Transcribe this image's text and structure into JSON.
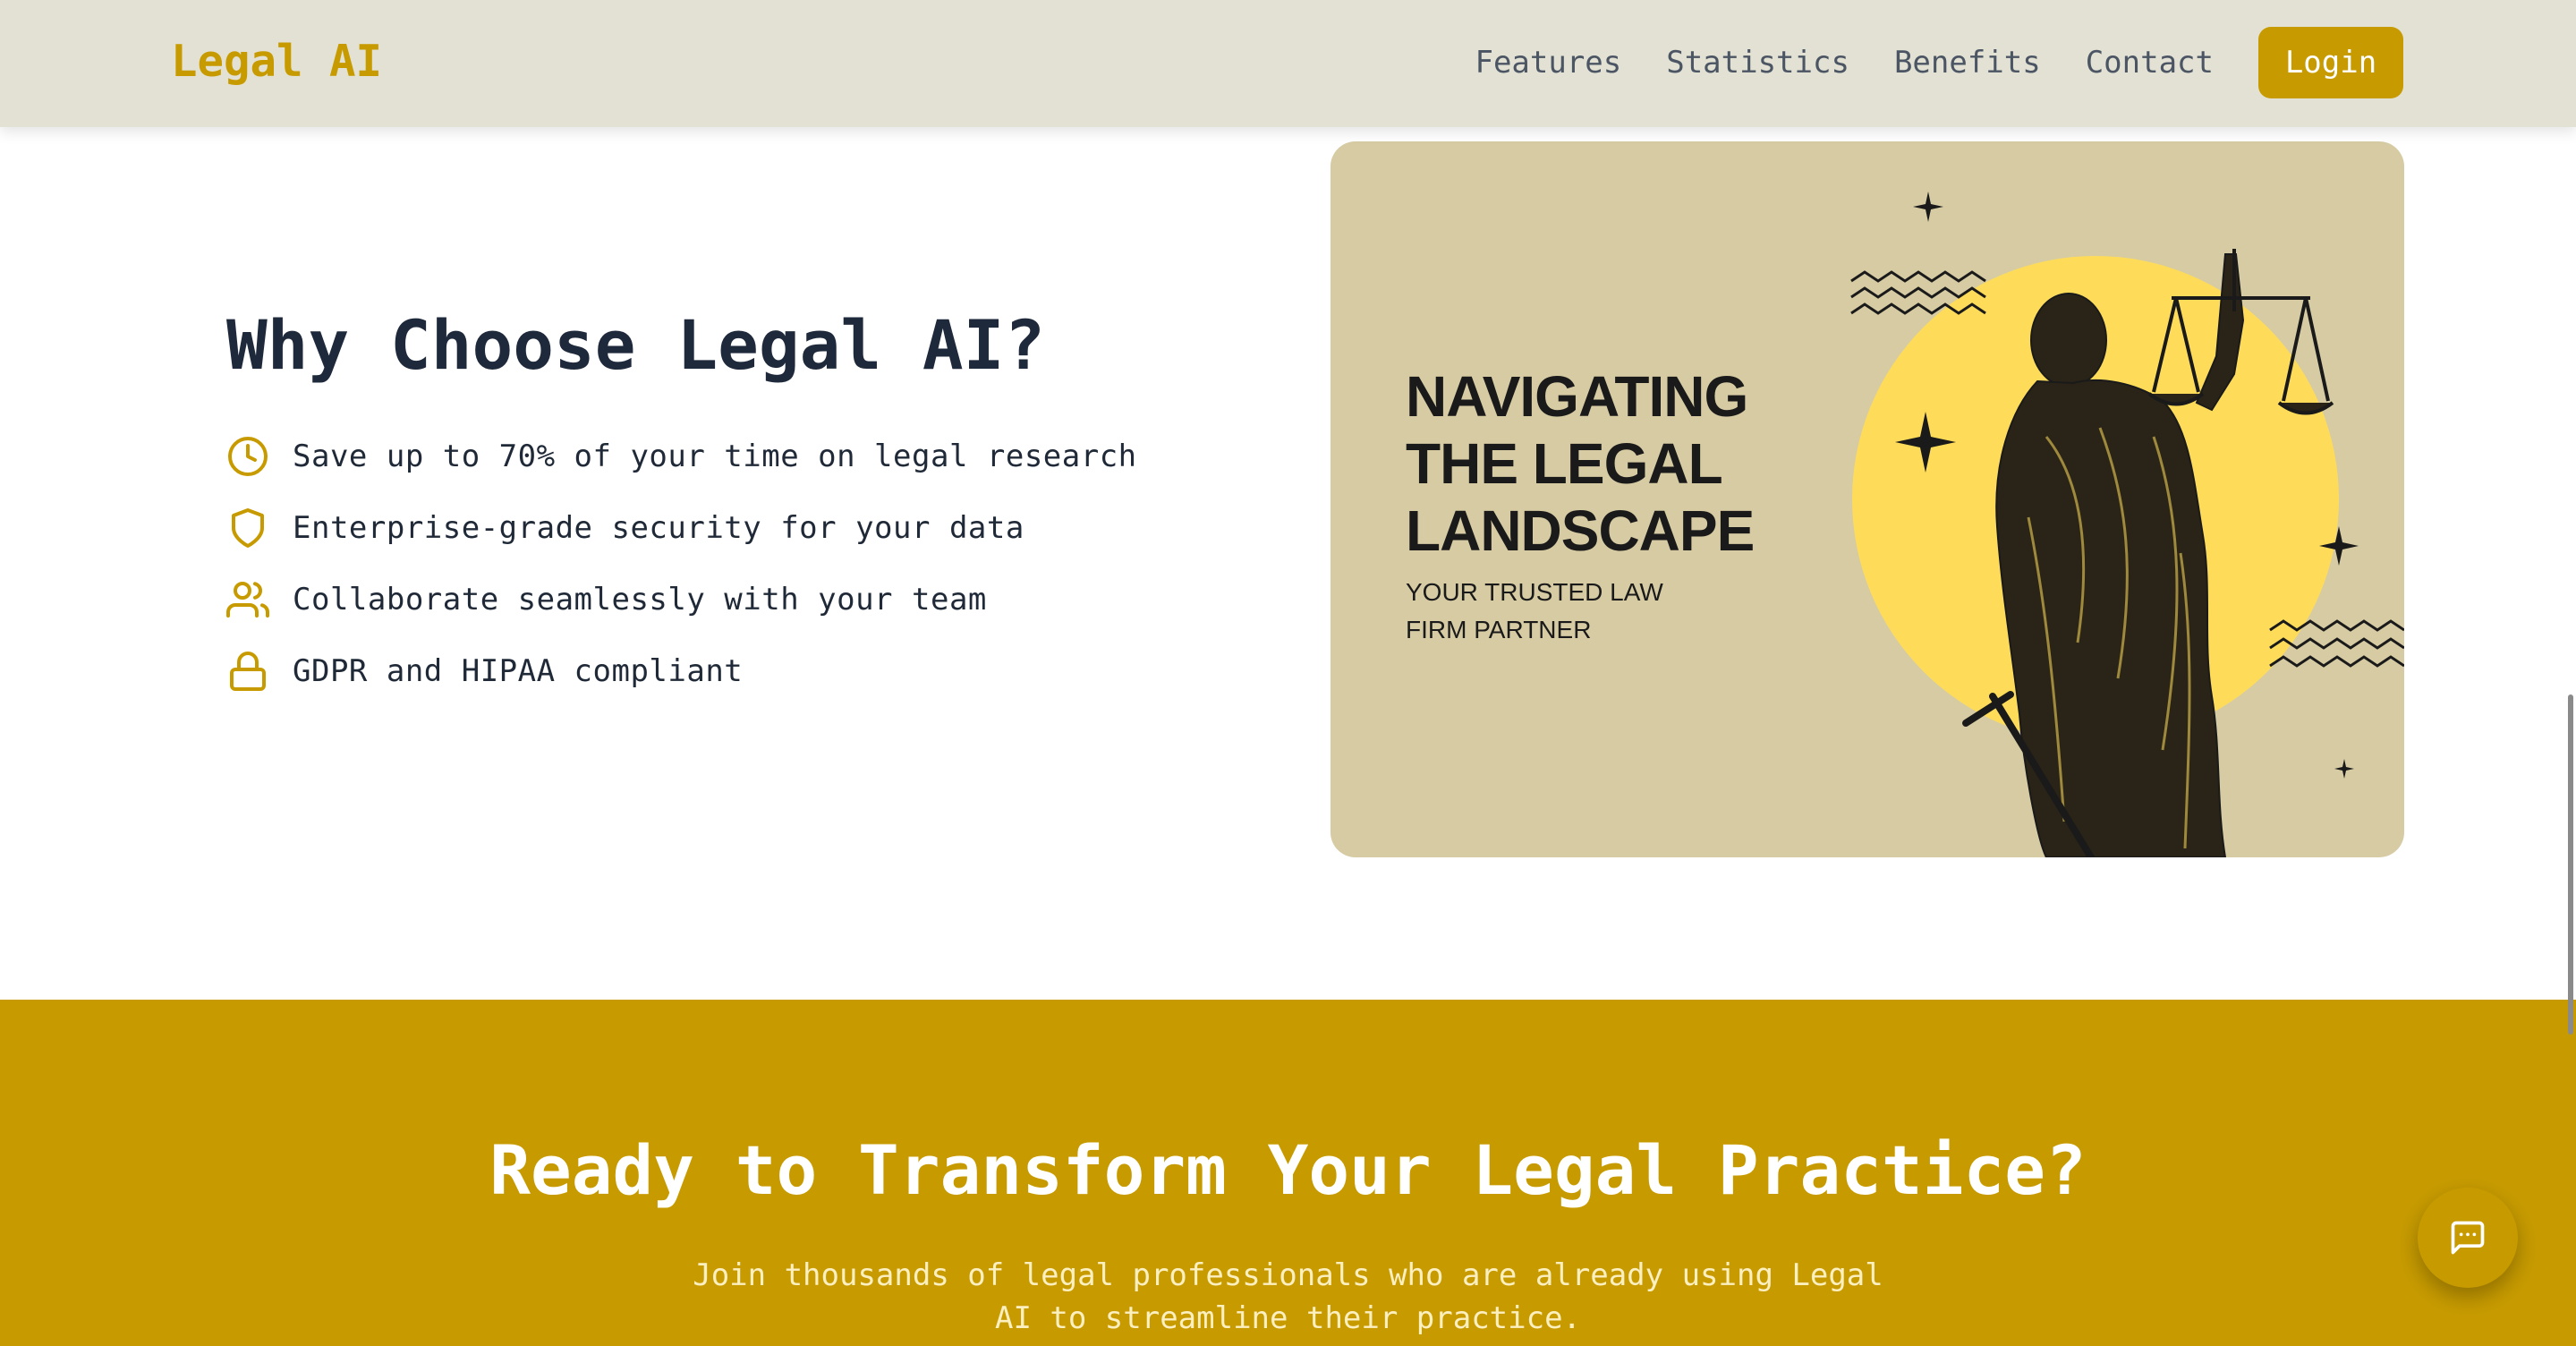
{
  "header": {
    "brand": "Legal AI",
    "nav": [
      "Features",
      "Statistics",
      "Benefits",
      "Contact"
    ],
    "login_label": "Login"
  },
  "benefits_section": {
    "title": "Why Choose Legal AI?",
    "items": [
      {
        "icon": "clock-icon",
        "text": "Save up to 70% of your time on legal research"
      },
      {
        "icon": "shield-icon",
        "text": "Enterprise-grade security for your data"
      },
      {
        "icon": "users-icon",
        "text": "Collaborate seamlessly with your team"
      },
      {
        "icon": "lock-icon",
        "text": "GDPR and HIPAA compliant"
      }
    ]
  },
  "hero_card": {
    "headline_lines": [
      "NAVIGATING",
      "THE LEGAL",
      "LANDSCAPE"
    ],
    "subline": "YOUR TRUSTED LAW FIRM PARTNER"
  },
  "cta": {
    "title": "Ready to Transform Your Legal Practice?",
    "text": "Join thousands of legal professionals who are already using Legal AI to streamline their practice."
  },
  "chat_button": {
    "icon": "chat-icon"
  },
  "colors": {
    "accent": "#c79b00",
    "header_bg": "#e2e1d3",
    "card_bg": "#d6cba3",
    "sun": "#fedc5a",
    "heading": "#1e293b"
  }
}
